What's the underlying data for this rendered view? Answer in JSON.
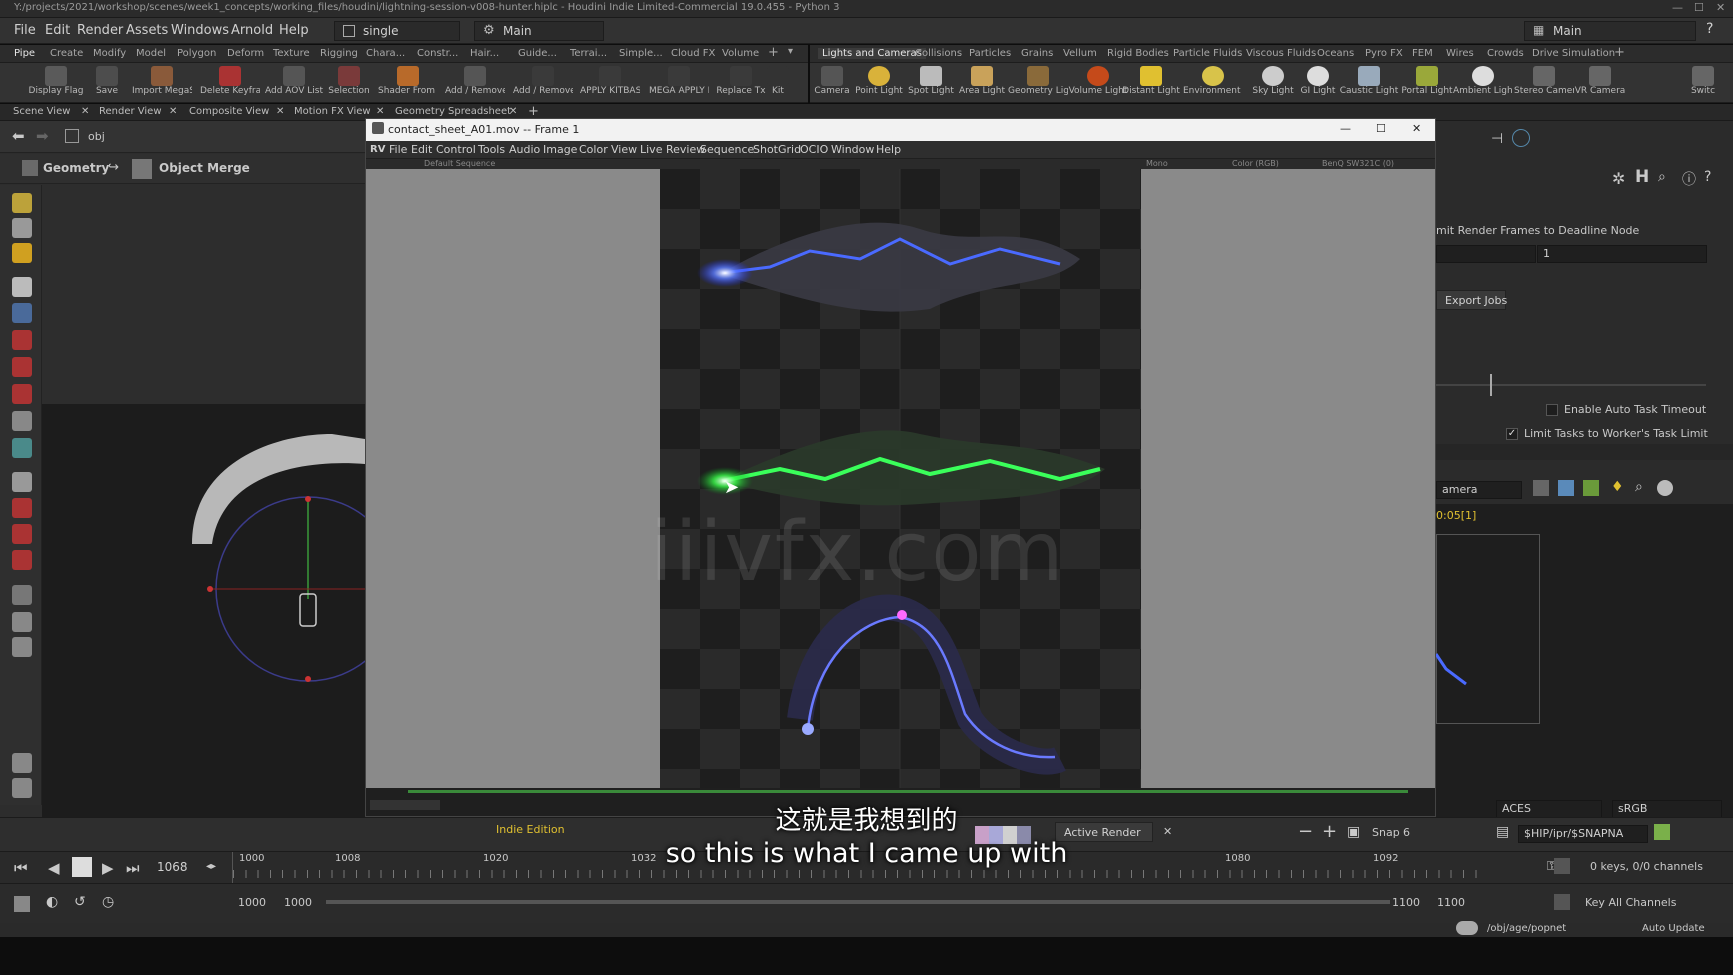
{
  "window_title": "Y:/projects/2021/workshop/scenes/week1_concepts/working_files/houdini/lightning-session-v008-hunter.hiplc - Houdini Indie Limited-Commercial 19.0.455 - Python 3",
  "menu": [
    "File",
    "Edit",
    "Render",
    "Assets",
    "Windows",
    "Arnold",
    "Help"
  ],
  "desktop_combo": "single",
  "layout_combo": "Main",
  "right_layout_combo": "Main",
  "shelf_tabs_left": [
    "Pipe",
    "Create",
    "Modify",
    "Model",
    "Polygon",
    "Deform",
    "Texture",
    "Rigging",
    "Chara...",
    "Constr...",
    "Hair...",
    "Guide...",
    "Terrai...",
    "Simple...",
    "Cloud FX",
    "Volume"
  ],
  "shelf_tabs_right": [
    "Lights and Cameras",
    "Collisions",
    "Particles",
    "Grains",
    "Vellum",
    "Rigid Bodies",
    "Particle Fluids",
    "Viscous Fluids",
    "Oceans",
    "Pyro FX",
    "FEM",
    "Wires",
    "Crowds",
    "Drive Simulation"
  ],
  "shelf_tools_left": [
    "Display Flag",
    "Save",
    "Import MegaScan T...",
    "Delete Keyframes",
    "Add AOV List",
    "Selection",
    "Shader From Materials",
    "Add / Remove Exports",
    "Add / Remove AOVs",
    "APPLY KITBASH M...",
    "MEGA APPLY MATERIALS",
    "Replace Tx",
    "Kit"
  ],
  "shelf_tools_right": [
    "Camera",
    "Point Light",
    "Spot Light",
    "Area Light",
    "Geometry Light",
    "Volume Light",
    "Distant Light",
    "Environment Light",
    "Sky Light",
    "GI Light",
    "Caustic Light",
    "Portal Light",
    "Ambient Light",
    "Stereo Camera",
    "VR Camera",
    "Switc"
  ],
  "pane_tabs": [
    "Scene View",
    "Render View",
    "Composite View",
    "Motion FX View",
    "Geometry Spreadsheet"
  ],
  "path": "obj",
  "node_context": "Geometry",
  "node_name": "Object Merge",
  "rv": {
    "title": "contact_sheet_A01.mov -- Frame 1",
    "menu": [
      "File",
      "Edit",
      "Control",
      "Tools",
      "Audio",
      "Image",
      "Color",
      "View",
      "Live Review",
      "Sequence",
      "ShotGrid",
      "OCIO",
      "Window",
      "Help"
    ],
    "sequence": "Default Sequence",
    "channel": "Mono",
    "color": "Color (RGB)",
    "display": "BenQ SW321C (0)"
  },
  "right_panel": {
    "deadline_label": "mit Render Frames to Deadline Node",
    "value": "1",
    "export_jobs": "Export Jobs",
    "auto_timeout": "Enable Auto Task Timeout",
    "limit_tasks": "Limit Tasks to Worker's Task Limit",
    "camera": "amera",
    "time_readout": "0:05[1]",
    "display_space": "ACES",
    "view_transform": "sRGB",
    "snap_path": "$HIP/ipr/$SNAPNA"
  },
  "bottom": {
    "edition": "Indie Edition",
    "active_render": "Active Render",
    "snap": "Snap",
    "snap_count": "6"
  },
  "timeline": {
    "current_frame": "1068",
    "ticks": [
      "1000",
      "1008",
      "1020",
      "1032",
      "1080",
      "1092"
    ],
    "range_start": "1000",
    "range_start2": "1000",
    "range_end": "1100",
    "range_end2": "1100",
    "keys": "0 keys, 0/0 channels",
    "key_all": "Key All Channels"
  },
  "status": {
    "path": "/obj/age/popnet",
    "auto_update": "Auto Update"
  },
  "watermark": "iiivfx.com",
  "subtitle_cn": "这就是我想到的",
  "subtitle_en": "so this is what I came up with"
}
